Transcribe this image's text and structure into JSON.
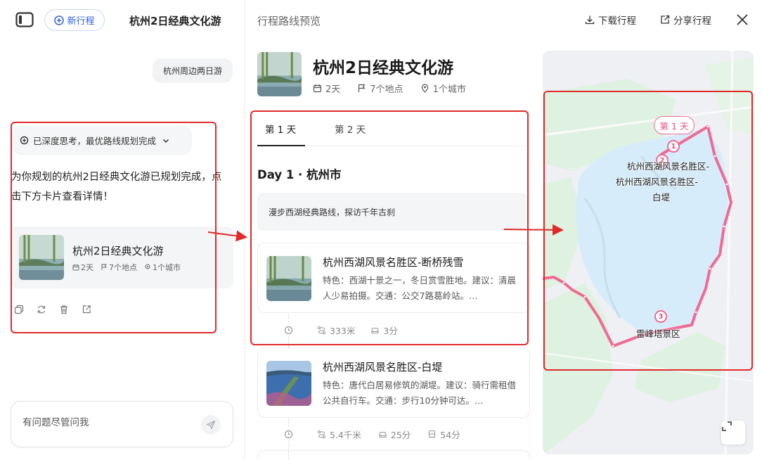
{
  "sidebar": {
    "new_trip_label": "新行程",
    "conversation_title": "杭州2日经典文化游"
  },
  "chat": {
    "user_message": "杭州周边两日游",
    "deep_think_label": "已深度思考，最优路线规划完成",
    "answer_text": "为你规划的杭州2日经典文化游已规划完成，点击下方卡片查看详情！",
    "plan_card": {
      "title": "杭州2日经典文化游",
      "days": "2天",
      "places": "7个地点",
      "cities": "1个城市"
    },
    "input_placeholder": "有问题尽管问我"
  },
  "preview": {
    "title": "行程路线预览",
    "download_label": "下载行程",
    "share_label": "分享行程",
    "trip_title": "杭州2日经典文化游",
    "days": "2天",
    "places": "7个地点",
    "cities": "1个城市",
    "tabs": [
      "第 1 天",
      "第 2 天"
    ],
    "day_title": "Day 1 · 杭州市",
    "day_subtitle": "漫步西湖经典路线，探访千年古刹",
    "spots": [
      {
        "name": "杭州西湖风景名胜区-断桥残雪",
        "desc": "特色：西湖十景之一，冬日赏雪胜地。建议：清晨人少易拍摄。交通：公交7路葛岭站。…",
        "transit": {
          "distance": "333米",
          "drive": "3分"
        }
      },
      {
        "name": "杭州西湖风景名胜区-白堤",
        "desc": "特色：唐代白居易修筑的湖堤。建议：骑行需租借公共自行车。交通：步行10分钟可达。…",
        "transit": {
          "distance": "5.4千米",
          "drive": "25分",
          "bus": "54分"
        }
      }
    ]
  },
  "map": {
    "day_pin": "第 1 天",
    "markers": [
      "1",
      "2",
      "3"
    ],
    "labels": {
      "spot1": "杭州西湖风景名胜区-",
      "spot2a": "杭州西湖风景名胜区-",
      "spot2b": "白堤",
      "spot3": "雷峰塔景区"
    },
    "route_color": "#f06a93",
    "water_color": "#d8eefb",
    "park_color": "#dff3e2"
  },
  "colors": {
    "accent": "#2f63d9",
    "annotation": "#e02a2a"
  }
}
